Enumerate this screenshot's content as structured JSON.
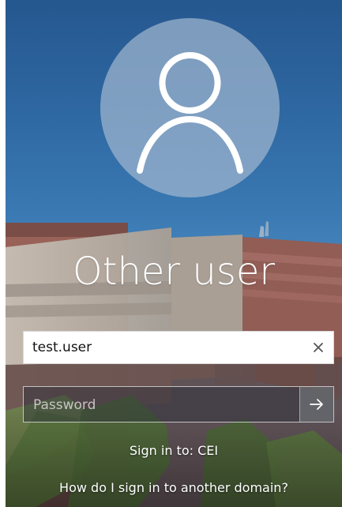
{
  "account": {
    "title": "Other user",
    "avatar_icon": "user-silhouette-icon"
  },
  "login": {
    "username_value": "test.user",
    "clear_icon": "close-icon",
    "password_placeholder": "Password",
    "submit_icon": "arrow-right-icon"
  },
  "signin": {
    "target_text": "Sign in to: CEI",
    "domain_link": "How do I sign in to another domain?"
  },
  "colors": {
    "sky": "#2d66a0",
    "brick": "#8c5b53",
    "accent_white": "#ffffff"
  }
}
